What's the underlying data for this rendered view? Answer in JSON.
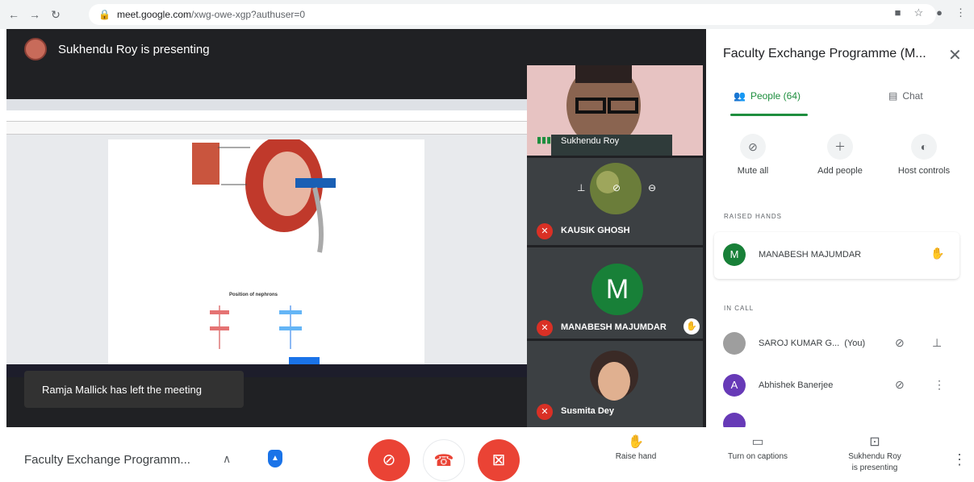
{
  "browser": {
    "url_host": "meet.google.com",
    "url_path": "/xwg-owe-xgp?authuser=0"
  },
  "stage": {
    "presenting_text": "Sukhendu Roy is presenting",
    "toast": "Ramja Mallick has left the meeting",
    "shared_doc_title": "Position of nephrons"
  },
  "tiles": [
    {
      "name": "Sukhendu Roy"
    },
    {
      "name": "KAUSIK GHOSH"
    },
    {
      "name": "MANABESH MAJUMDAR",
      "initial": "M"
    },
    {
      "name": "Susmita Dey"
    }
  ],
  "panel": {
    "title": "Faculty Exchange Programme (M...",
    "tabs": {
      "people": "People (64)",
      "chat": "Chat"
    },
    "actions": {
      "mute_all": "Mute all",
      "add_people": "Add people",
      "host_controls": "Host controls"
    },
    "raised_hands_heading": "RAISED HANDS",
    "in_call_heading": "IN CALL",
    "raised": [
      {
        "initial": "M",
        "name": "MANABESH MAJUMDAR"
      }
    ],
    "in_call": [
      {
        "name": "SAROJ KUMAR G...",
        "suffix": "(You)"
      },
      {
        "initial": "A",
        "name": "Abhishek Banerjee"
      }
    ]
  },
  "bottom": {
    "meeting_title": "Faculty Exchange Programm...",
    "raise_hand": "Raise hand",
    "captions": "Turn on captions",
    "presenting_line1": "Sukhendu Roy",
    "presenting_line2": "is presenting"
  },
  "colors": {
    "end_call_red": "#ea4335",
    "people_tab_green": "#1e8e3e",
    "avatar_m_green": "#188038",
    "avatar_a_purple": "#673ab7"
  }
}
